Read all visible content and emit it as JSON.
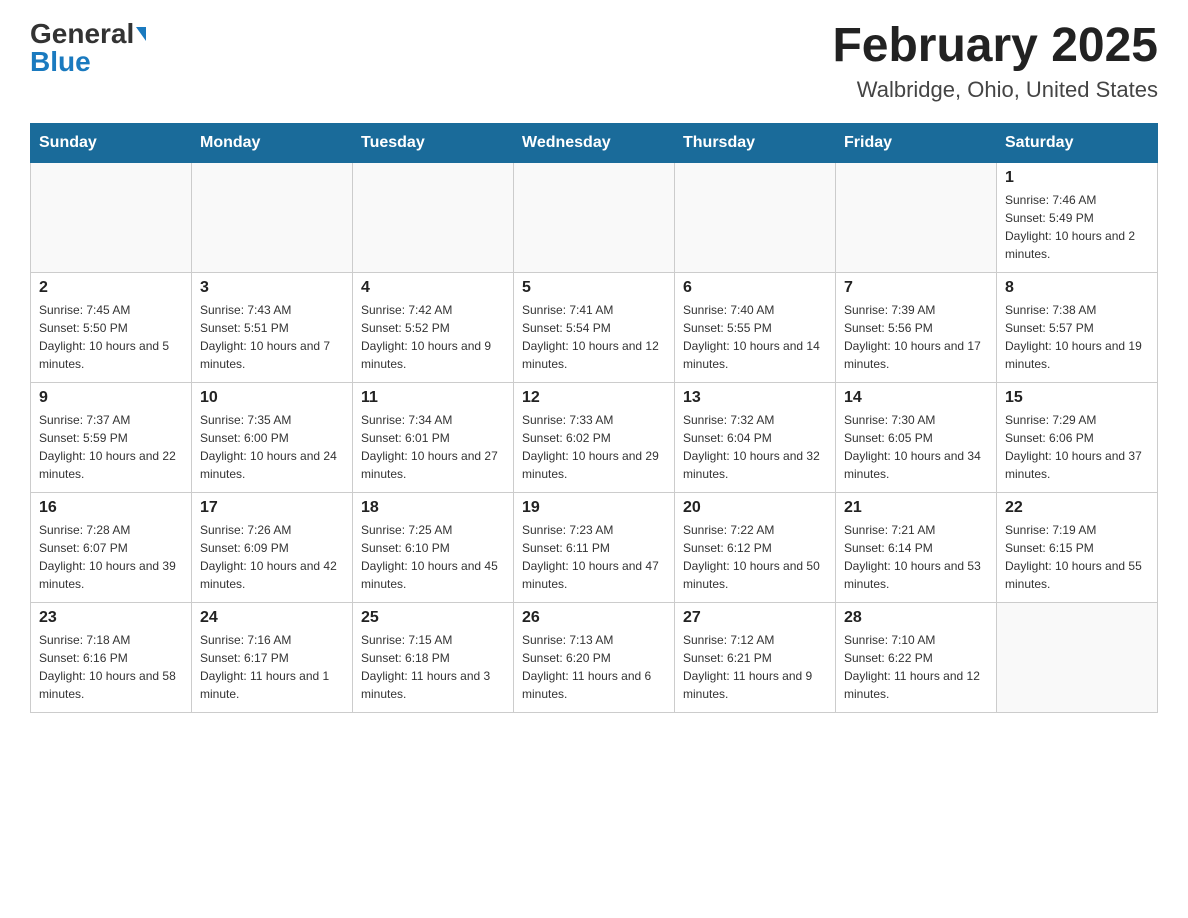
{
  "header": {
    "logo_general": "General",
    "logo_blue": "Blue",
    "month_title": "February 2025",
    "location": "Walbridge, Ohio, United States"
  },
  "weekdays": [
    "Sunday",
    "Monday",
    "Tuesday",
    "Wednesday",
    "Thursday",
    "Friday",
    "Saturday"
  ],
  "weeks": [
    [
      {
        "day": "",
        "info": ""
      },
      {
        "day": "",
        "info": ""
      },
      {
        "day": "",
        "info": ""
      },
      {
        "day": "",
        "info": ""
      },
      {
        "day": "",
        "info": ""
      },
      {
        "day": "",
        "info": ""
      },
      {
        "day": "1",
        "info": "Sunrise: 7:46 AM\nSunset: 5:49 PM\nDaylight: 10 hours and 2 minutes."
      }
    ],
    [
      {
        "day": "2",
        "info": "Sunrise: 7:45 AM\nSunset: 5:50 PM\nDaylight: 10 hours and 5 minutes."
      },
      {
        "day": "3",
        "info": "Sunrise: 7:43 AM\nSunset: 5:51 PM\nDaylight: 10 hours and 7 minutes."
      },
      {
        "day": "4",
        "info": "Sunrise: 7:42 AM\nSunset: 5:52 PM\nDaylight: 10 hours and 9 minutes."
      },
      {
        "day": "5",
        "info": "Sunrise: 7:41 AM\nSunset: 5:54 PM\nDaylight: 10 hours and 12 minutes."
      },
      {
        "day": "6",
        "info": "Sunrise: 7:40 AM\nSunset: 5:55 PM\nDaylight: 10 hours and 14 minutes."
      },
      {
        "day": "7",
        "info": "Sunrise: 7:39 AM\nSunset: 5:56 PM\nDaylight: 10 hours and 17 minutes."
      },
      {
        "day": "8",
        "info": "Sunrise: 7:38 AM\nSunset: 5:57 PM\nDaylight: 10 hours and 19 minutes."
      }
    ],
    [
      {
        "day": "9",
        "info": "Sunrise: 7:37 AM\nSunset: 5:59 PM\nDaylight: 10 hours and 22 minutes."
      },
      {
        "day": "10",
        "info": "Sunrise: 7:35 AM\nSunset: 6:00 PM\nDaylight: 10 hours and 24 minutes."
      },
      {
        "day": "11",
        "info": "Sunrise: 7:34 AM\nSunset: 6:01 PM\nDaylight: 10 hours and 27 minutes."
      },
      {
        "day": "12",
        "info": "Sunrise: 7:33 AM\nSunset: 6:02 PM\nDaylight: 10 hours and 29 minutes."
      },
      {
        "day": "13",
        "info": "Sunrise: 7:32 AM\nSunset: 6:04 PM\nDaylight: 10 hours and 32 minutes."
      },
      {
        "day": "14",
        "info": "Sunrise: 7:30 AM\nSunset: 6:05 PM\nDaylight: 10 hours and 34 minutes."
      },
      {
        "day": "15",
        "info": "Sunrise: 7:29 AM\nSunset: 6:06 PM\nDaylight: 10 hours and 37 minutes."
      }
    ],
    [
      {
        "day": "16",
        "info": "Sunrise: 7:28 AM\nSunset: 6:07 PM\nDaylight: 10 hours and 39 minutes."
      },
      {
        "day": "17",
        "info": "Sunrise: 7:26 AM\nSunset: 6:09 PM\nDaylight: 10 hours and 42 minutes."
      },
      {
        "day": "18",
        "info": "Sunrise: 7:25 AM\nSunset: 6:10 PM\nDaylight: 10 hours and 45 minutes."
      },
      {
        "day": "19",
        "info": "Sunrise: 7:23 AM\nSunset: 6:11 PM\nDaylight: 10 hours and 47 minutes."
      },
      {
        "day": "20",
        "info": "Sunrise: 7:22 AM\nSunset: 6:12 PM\nDaylight: 10 hours and 50 minutes."
      },
      {
        "day": "21",
        "info": "Sunrise: 7:21 AM\nSunset: 6:14 PM\nDaylight: 10 hours and 53 minutes."
      },
      {
        "day": "22",
        "info": "Sunrise: 7:19 AM\nSunset: 6:15 PM\nDaylight: 10 hours and 55 minutes."
      }
    ],
    [
      {
        "day": "23",
        "info": "Sunrise: 7:18 AM\nSunset: 6:16 PM\nDaylight: 10 hours and 58 minutes."
      },
      {
        "day": "24",
        "info": "Sunrise: 7:16 AM\nSunset: 6:17 PM\nDaylight: 11 hours and 1 minute."
      },
      {
        "day": "25",
        "info": "Sunrise: 7:15 AM\nSunset: 6:18 PM\nDaylight: 11 hours and 3 minutes."
      },
      {
        "day": "26",
        "info": "Sunrise: 7:13 AM\nSunset: 6:20 PM\nDaylight: 11 hours and 6 minutes."
      },
      {
        "day": "27",
        "info": "Sunrise: 7:12 AM\nSunset: 6:21 PM\nDaylight: 11 hours and 9 minutes."
      },
      {
        "day": "28",
        "info": "Sunrise: 7:10 AM\nSunset: 6:22 PM\nDaylight: 11 hours and 12 minutes."
      },
      {
        "day": "",
        "info": ""
      }
    ]
  ]
}
